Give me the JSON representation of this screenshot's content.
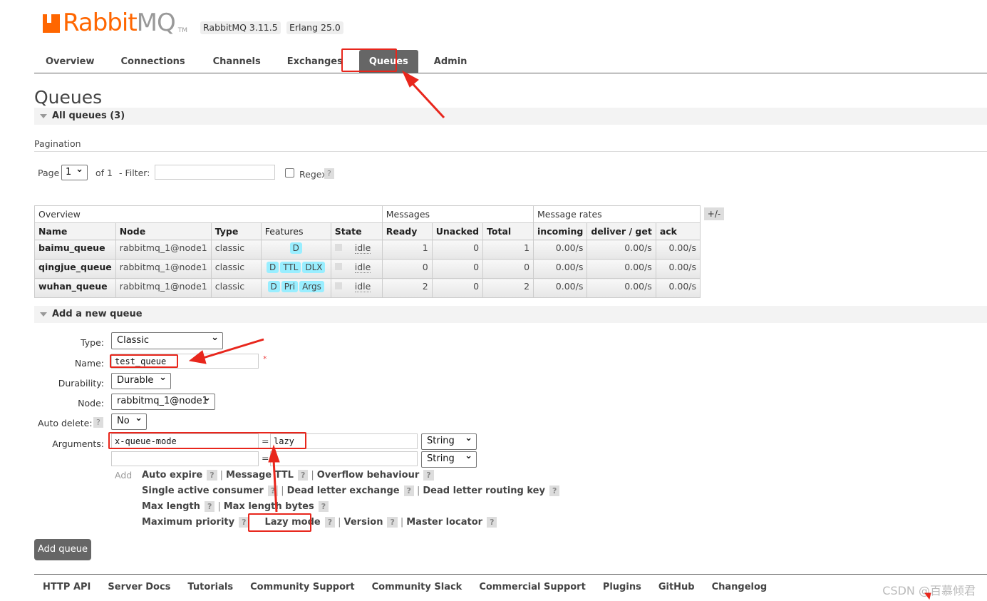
{
  "header": {
    "logo": {
      "brand1": "Rabbit",
      "brand2": "MQ",
      "tm": "TM"
    },
    "rabbitmq_version": "RabbitMQ 3.11.5",
    "erlang_version": "Erlang 25.0"
  },
  "nav": {
    "tabs": [
      {
        "label": "Overview"
      },
      {
        "label": "Connections"
      },
      {
        "label": "Channels"
      },
      {
        "label": "Exchanges"
      },
      {
        "label": "Queues",
        "active": true
      },
      {
        "label": "Admin"
      }
    ]
  },
  "page": {
    "title": "Queues",
    "all_queues": "All queues (3)"
  },
  "pagination": {
    "heading": "Pagination",
    "page_label": "Page",
    "page_value": "1",
    "of_label": "of 1",
    "filter_label": "- Filter:",
    "filter_value": "",
    "regex_label": "Regex",
    "help": "?"
  },
  "table": {
    "groups": [
      "Overview",
      "Messages",
      "Message rates"
    ],
    "toggle": "+/-",
    "columns": [
      "Name",
      "Node",
      "Type",
      "Features",
      "State",
      "Ready",
      "Unacked",
      "Total",
      "incoming",
      "deliver / get",
      "ack"
    ],
    "rows": [
      {
        "name": "baimu_queue",
        "node": "rabbitmq_1@node1",
        "type": "classic",
        "features": [
          "D"
        ],
        "state": "idle",
        "ready": "1",
        "unacked": "0",
        "total": "1",
        "incoming": "0.00/s",
        "deliver": "0.00/s",
        "ack": "0.00/s"
      },
      {
        "name": "qingjue_queue",
        "node": "rabbitmq_1@node1",
        "type": "classic",
        "features": [
          "D",
          "TTL",
          "DLX"
        ],
        "state": "idle",
        "ready": "0",
        "unacked": "0",
        "total": "0",
        "incoming": "0.00/s",
        "deliver": "0.00/s",
        "ack": "0.00/s"
      },
      {
        "name": "wuhan_queue",
        "node": "rabbitmq_1@node1",
        "type": "classic",
        "features": [
          "D",
          "Pri",
          "Args"
        ],
        "state": "idle",
        "ready": "2",
        "unacked": "0",
        "total": "2",
        "incoming": "0.00/s",
        "deliver": "0.00/s",
        "ack": "0.00/s"
      }
    ]
  },
  "add_queue": {
    "heading": "Add a new queue",
    "type_label": "Type:",
    "type_value": "Classic",
    "name_label": "Name:",
    "name_value": "test_queue",
    "required": "*",
    "durability_label": "Durability:",
    "durability_value": "Durable",
    "node_label": "Node:",
    "node_value": "rabbitmq_1@node1",
    "auto_delete_label": "Auto delete:",
    "auto_delete_value": "No",
    "help": "?",
    "arguments_label": "Arguments:",
    "arguments": [
      {
        "key": "x-queue-mode",
        "value": "lazy",
        "type": "String"
      },
      {
        "key": "",
        "value": "",
        "type": "String"
      }
    ],
    "eq": "=",
    "add_label": "Add",
    "arg_lines": [
      [
        "Auto expire",
        "Message TTL",
        "Overflow behaviour"
      ],
      [
        "Single active consumer",
        "Dead letter exchange",
        "Dead letter routing key"
      ],
      [
        "Max length",
        "Max length bytes"
      ],
      [
        "Maximum priority",
        "Lazy mode",
        "Version",
        "Master locator"
      ]
    ],
    "submit": "Add queue"
  },
  "footer": {
    "links": [
      "HTTP API",
      "Server Docs",
      "Tutorials",
      "Community Support",
      "Community Slack",
      "Commercial Support",
      "Plugins",
      "GitHub",
      "Changelog"
    ]
  },
  "watermark": "CSDN @百慕倾君",
  "colors": {
    "brand": "#ff6600",
    "annotation": "#e8261c",
    "badge": "#99eeff"
  }
}
